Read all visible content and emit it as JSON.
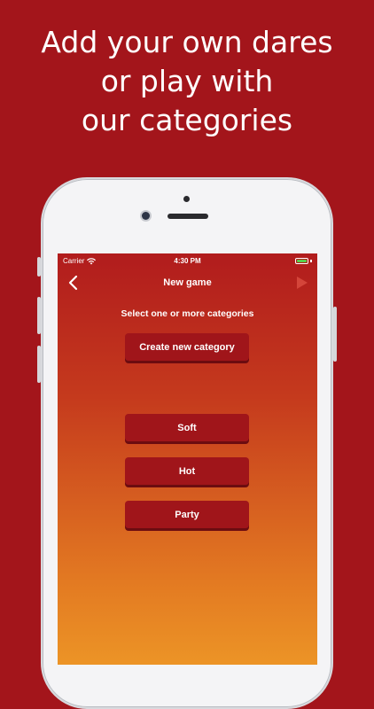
{
  "headline": [
    "Add your own dares",
    "or play with",
    "our categories"
  ],
  "status_bar": {
    "carrier": "Carrier",
    "time": "4:30 PM"
  },
  "nav": {
    "title": "New game"
  },
  "screen": {
    "prompt": "Select one or more categories",
    "create_button": "Create new category",
    "categories": [
      "Soft",
      "Hot",
      "Party"
    ]
  },
  "colors": {
    "background": "#a3151b",
    "button": "#a0151a",
    "gradient_top": "#b11c1d",
    "gradient_bottom": "#ec9426",
    "battery": "#5ad04a"
  },
  "icons": [
    "wifi-icon",
    "battery-icon",
    "back-chevron-icon",
    "play-icon"
  ]
}
